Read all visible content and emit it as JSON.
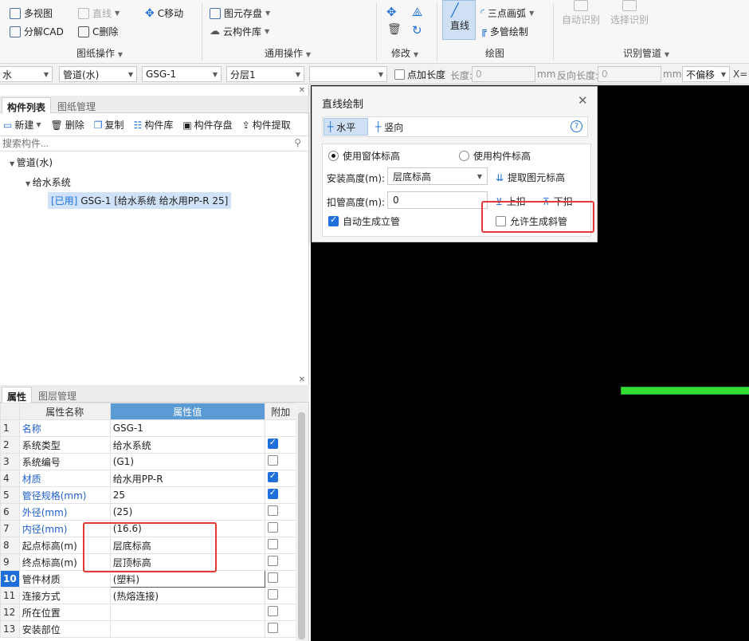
{
  "ribbon": {
    "multi_view": "多视图",
    "line": "直线",
    "c_move": "C移动",
    "explode_cad": "分解CAD",
    "c_delete": "C删除",
    "group_drawing_ops": "图纸操作",
    "element_save": "图元存盘",
    "cloud_library": "云构件库",
    "group_common_ops": "通用操作",
    "group_modify": "修改",
    "straight_line": "直线",
    "three_point_arc": "三点画弧",
    "multi_pipe_draw": "多管绘制",
    "group_draw": "绘图",
    "auto_recognize": "自动识别",
    "select_recognize": "选择识别",
    "group_recognize_pipe": "识别管道"
  },
  "toolbar": {
    "combo1": "水",
    "combo2": "管道(水)",
    "combo3": "GSG-1",
    "combo4": "分层1",
    "combo5": "",
    "point_length_label": "点加长度",
    "length_label": "长度:",
    "length_value": "0",
    "mm1": "mm",
    "reverse_length_label": "反向长度:",
    "reverse_length_value": "0",
    "mm2": "mm",
    "offset": "不偏移",
    "x_label": "X="
  },
  "component_panel": {
    "tab_list": "构件列表",
    "tab_drawing": "图纸管理",
    "new": "新建",
    "delete": "删除",
    "copy": "复制",
    "library": "构件库",
    "save": "构件存盘",
    "extract": "构件提取",
    "search_placeholder": "搜索构件...",
    "tree_root": "管道(水)",
    "tree_child": "给水系统",
    "tree_used_tag": "[已用]",
    "tree_leaf": "GSG-1 [给水系统 给水用PP-R 25]"
  },
  "property_panel": {
    "tab_props": "属性",
    "tab_layers": "图层管理",
    "col_name": "属性名称",
    "col_value": "属性值",
    "col_add": "附加",
    "rows": [
      {
        "num": "1",
        "name": "名称",
        "value": "GSG-1",
        "blue": true,
        "check": null
      },
      {
        "num": "2",
        "name": "系统类型",
        "value": "给水系统",
        "blue": false,
        "check": true
      },
      {
        "num": "3",
        "name": "系统编号",
        "value": "(G1)",
        "blue": false,
        "check": false
      },
      {
        "num": "4",
        "name": "材质",
        "value": "给水用PP-R",
        "blue": true,
        "check": true
      },
      {
        "num": "5",
        "name": "管径规格(mm)",
        "value": "25",
        "blue": true,
        "check": true
      },
      {
        "num": "6",
        "name": "外径(mm)",
        "value": "(25)",
        "blue": true,
        "check": false
      },
      {
        "num": "7",
        "name": "内径(mm)",
        "value": "(16.6)",
        "blue": true,
        "check": false
      },
      {
        "num": "8",
        "name": "起点标高(m)",
        "value": "层底标高",
        "blue": false,
        "check": false
      },
      {
        "num": "9",
        "name": "终点标高(m)",
        "value": "层顶标高",
        "blue": false,
        "check": false
      },
      {
        "num": "10",
        "name": "管件材质",
        "value": "(塑料)",
        "blue": false,
        "check": false
      },
      {
        "num": "11",
        "name": "连接方式",
        "value": "(热熔连接)",
        "blue": false,
        "check": false
      },
      {
        "num": "12",
        "name": "所在位置",
        "value": "",
        "blue": false,
        "check": false
      },
      {
        "num": "13",
        "name": "安装部位",
        "value": "",
        "blue": false,
        "check": false
      }
    ]
  },
  "dialog": {
    "title": "直线绘制",
    "horizontal": "水平",
    "vertical": "竖向",
    "help": "?",
    "use_window_elev": "使用窗体标高",
    "use_comp_elev": "使用构件标高",
    "install_height_label": "安装高度(m):",
    "install_height_value": "层底标高",
    "extract_elev": "提取图元标高",
    "deduct_height_label": "扣管高度(m):",
    "deduct_height_value": "0",
    "up_deduct": "上扣",
    "down_deduct": "下扣",
    "auto_riser": "自动生成立管",
    "allow_slope": "允许生成斜管"
  },
  "colors": {
    "pipe_green": "#33dd33",
    "highlight_red": "#e53935",
    "accent_blue": "#1e6fd9"
  }
}
